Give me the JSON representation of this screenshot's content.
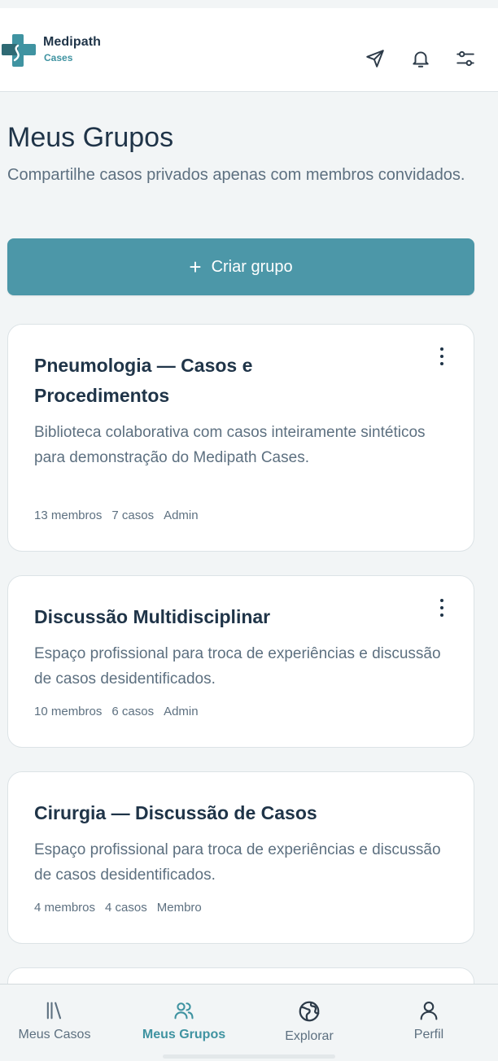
{
  "brand": {
    "name": "Medipath",
    "sub": "Cases"
  },
  "header_icons": [
    "send-icon",
    "bell-icon",
    "filter-sliders-icon"
  ],
  "page": {
    "title": "Meus Grupos",
    "subtitle": "Compartilhe casos privados apenas com membros convidados."
  },
  "create_button": {
    "icon": "+",
    "label": "Criar grupo"
  },
  "groups": [
    {
      "title": "Pneumologia — Casos e Procedimentos",
      "description": "Biblioteca colaborativa com casos inteiramente sintéticos para demonstração do Medipath Cases.",
      "members": "13 membros",
      "cases": "7 casos",
      "role": "Admin"
    },
    {
      "title": "Discussão Multidisciplinar",
      "description": "Espaço profissional para troca de experiências e discussão de casos desidentificados.",
      "members": "10 membros",
      "cases": "6 casos",
      "role": "Admin"
    },
    {
      "title": "Cirurgia — Discussão de Casos",
      "description": "Espaço profissional para troca de experiências e discussão de casos desidentificados.",
      "members": "4 membros",
      "cases": "4 casos",
      "role": "Membro"
    }
  ],
  "bottom_nav": [
    {
      "label": "Meus Casos",
      "icon": "library-icon",
      "active": false
    },
    {
      "label": "Meus Grupos",
      "icon": "users-icon",
      "active": true
    },
    {
      "label": "Explorar",
      "icon": "globe-icon",
      "active": false
    },
    {
      "label": "Perfil",
      "icon": "user-icon",
      "active": false
    }
  ],
  "colors": {
    "accent": "#4c97a8",
    "brand_teal": "#3f93a1",
    "text_dark": "#1f3448",
    "text_muted": "#5d7080"
  }
}
